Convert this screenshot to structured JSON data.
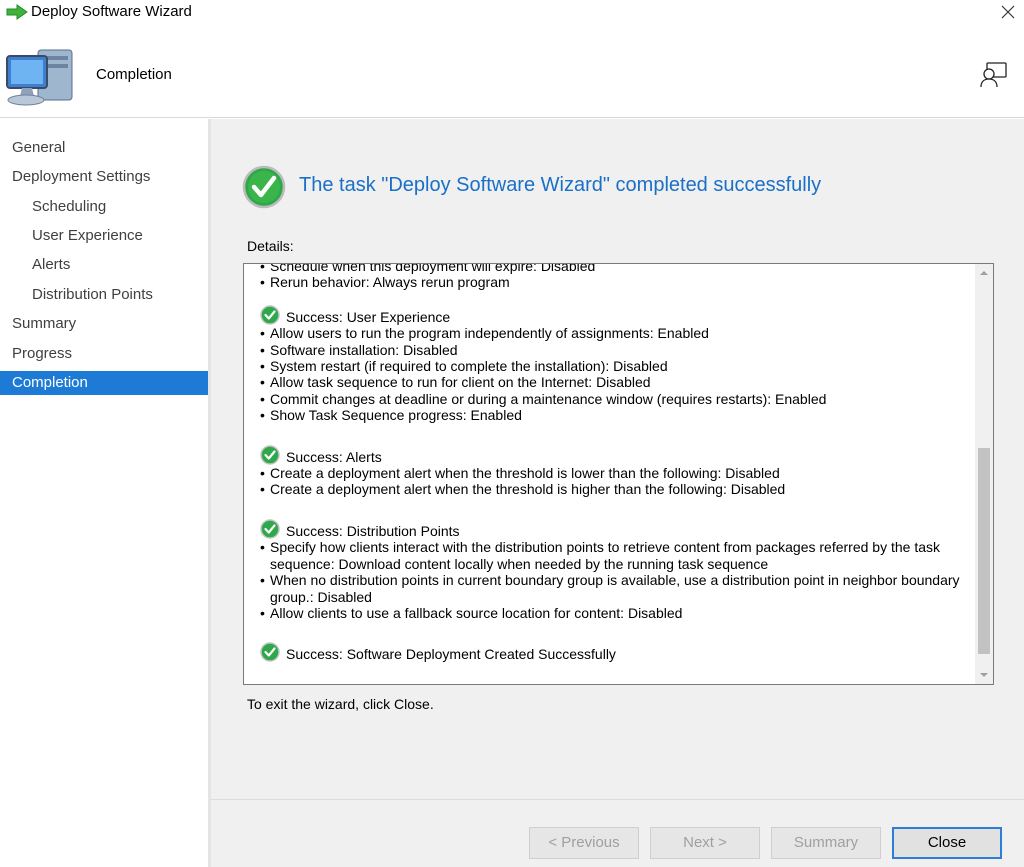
{
  "window": {
    "title": "Deploy Software Wizard",
    "close_icon": "close-icon"
  },
  "header": {
    "title": "Completion",
    "icon": "computer-icon",
    "feedback_icon": "feedback-icon"
  },
  "nav": {
    "items": [
      {
        "label": "General",
        "level": 0,
        "active": false
      },
      {
        "label": "Deployment Settings",
        "level": 0,
        "active": false
      },
      {
        "label": "Scheduling",
        "level": 1,
        "active": false
      },
      {
        "label": "User Experience",
        "level": 1,
        "active": false
      },
      {
        "label": "Alerts",
        "level": 1,
        "active": false
      },
      {
        "label": "Distribution Points",
        "level": 1,
        "active": false
      },
      {
        "label": "Summary",
        "level": 0,
        "active": false
      },
      {
        "label": "Progress",
        "level": 0,
        "active": false
      },
      {
        "label": "Completion",
        "level": 0,
        "active": true
      }
    ],
    "active_color": "#1e7bd5"
  },
  "main": {
    "status_text": "The task \"Deploy Software Wizard\" completed successfully",
    "status_color": "#1a6fc7",
    "details_label": "Details:",
    "exit_text": "To exit the wizard, click Close.",
    "details": {
      "top_partial": "Schedule when this deployment will expire: Disabled",
      "top_bullet": "Rerun behavior: Always rerun program",
      "sections": [
        {
          "title": "Success: User Experience",
          "bullets": [
            "Allow users to run the program independently of assignments: Enabled",
            "Software installation: Disabled",
            "System restart (if required to complete the installation): Disabled",
            "Allow task sequence to run for client on the Internet: Disabled",
            "Commit changes at deadline or during a maintenance window (requires restarts): Enabled",
            "Show Task Sequence progress: Enabled"
          ]
        },
        {
          "title": "Success: Alerts",
          "bullets": [
            "Create a deployment alert when the threshold is lower than the following: Disabled",
            "Create a deployment alert when the threshold is higher than the following: Disabled"
          ]
        },
        {
          "title": "Success: Distribution Points",
          "bullets": [
            "Specify how clients interact with the distribution points to retrieve content from packages referred by the task sequence: Download content locally when needed by the running task sequence",
            "When no distribution points in current boundary group is available, use a distribution point in neighbor boundary group.: Disabled",
            "Allow clients to use a fallback source location for content: Disabled"
          ]
        },
        {
          "title": "Success: Software Deployment Created Successfully",
          "bullets": []
        }
      ]
    }
  },
  "footer": {
    "previous_label": "< Previous",
    "next_label": "Next >",
    "summary_label": "Summary",
    "close_label": "Close"
  }
}
